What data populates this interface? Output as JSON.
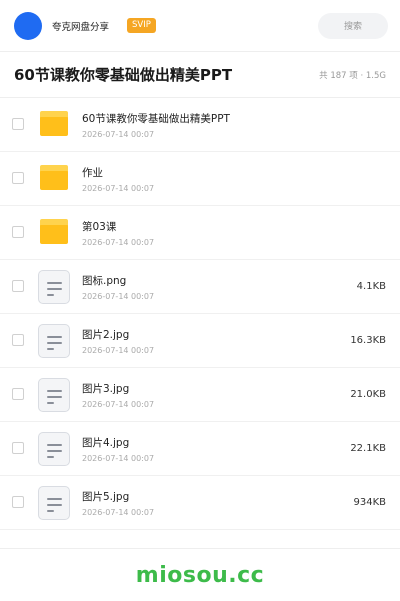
{
  "header": {
    "brand": "夸克网盘分享",
    "badge": "SVIP",
    "search_placeholder": "搜索"
  },
  "share": {
    "title": "60节课教你零基础做出精美PPT",
    "meta": "共 187 项 · 1.5G"
  },
  "files": [
    {
      "type": "folder",
      "name": "60节课教你零基础做出精美PPT",
      "date": "2026-07-14 00:07",
      "size": ""
    },
    {
      "type": "folder",
      "name": "作业",
      "date": "2026-07-14 00:07",
      "size": ""
    },
    {
      "type": "folder",
      "name": "第03课",
      "date": "2026-07-14 00:07",
      "size": ""
    },
    {
      "type": "file",
      "name": "图标.png",
      "date": "2026-07-14 00:07",
      "size": "4.1KB"
    },
    {
      "type": "file",
      "name": "图片2.jpg",
      "date": "2026-07-14 00:07",
      "size": "16.3KB"
    },
    {
      "type": "file",
      "name": "图片3.jpg",
      "date": "2026-07-14 00:07",
      "size": "21.0KB"
    },
    {
      "type": "file",
      "name": "图片4.jpg",
      "date": "2026-07-14 00:07",
      "size": "22.1KB"
    },
    {
      "type": "file",
      "name": "图片5.jpg",
      "date": "2026-07-14 00:07",
      "size": "934KB"
    }
  ],
  "footer": {
    "watermark": "miosou.cc"
  },
  "colors": {
    "accent": "#1f6bf2",
    "svip": "#f5a623",
    "folder": "#ffbf1a",
    "watermark": "#3dbb4a"
  }
}
